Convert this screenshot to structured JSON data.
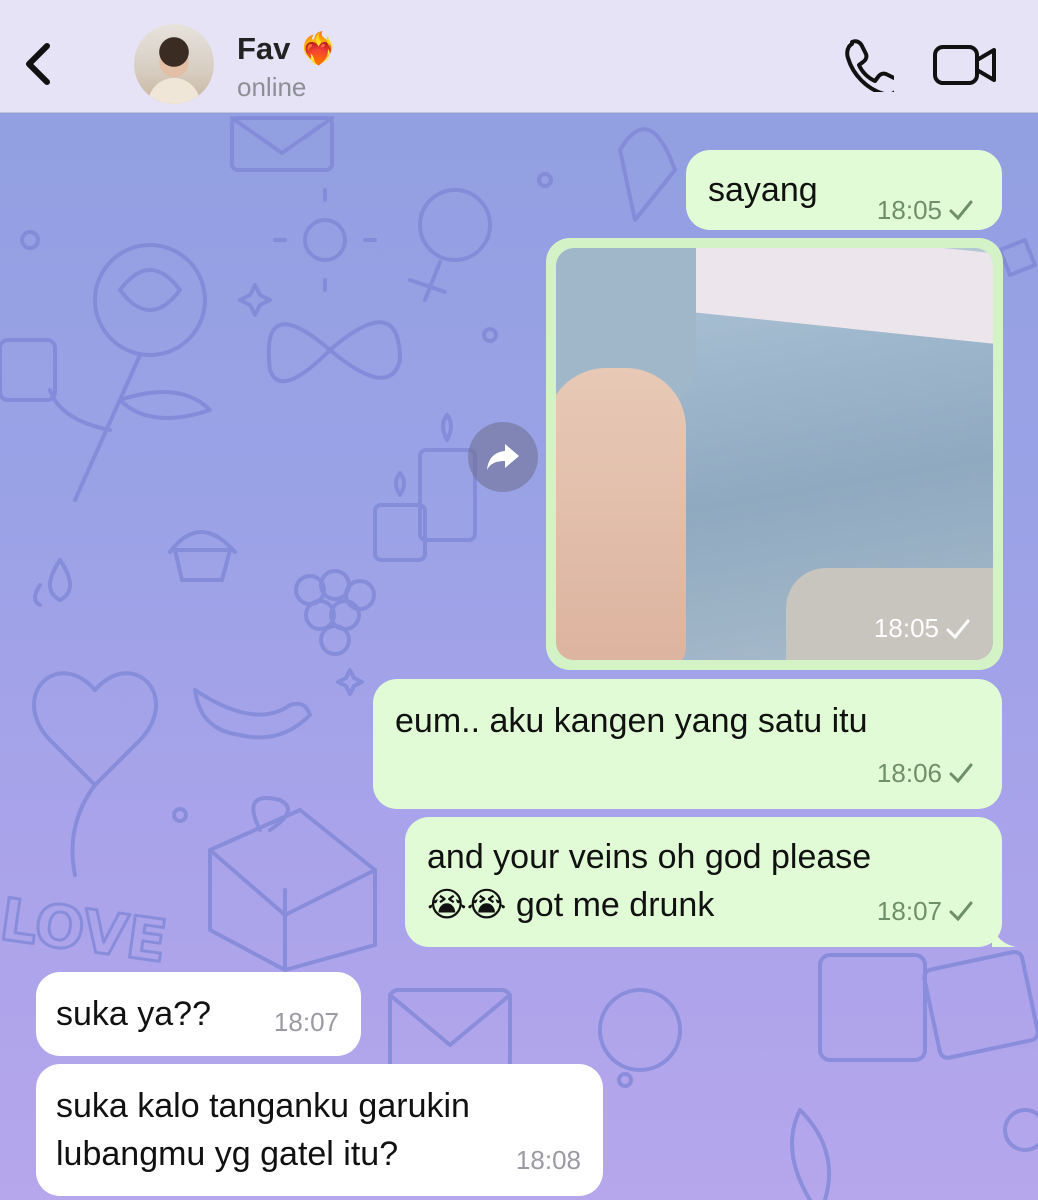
{
  "header": {
    "contact_name": "Fav ❤️‍🔥",
    "status": "online"
  },
  "icons": {
    "back": "chevron-left-icon",
    "call": "phone-icon",
    "video": "video-camera-icon",
    "share": "share-arrow-icon",
    "read": "checkmark-icon"
  },
  "colors": {
    "outgoing_bubble": "#e1fbd6",
    "incoming_bubble": "#ffffff",
    "header_bg": "#e8e6f6"
  },
  "messages": [
    {
      "direction": "out",
      "text": "sayang",
      "time": "18:05",
      "read": true
    },
    {
      "direction": "out",
      "type": "photo",
      "time": "18:05",
      "read": true
    },
    {
      "direction": "out",
      "text": "eum.. aku kangen yang satu itu",
      "time": "18:06",
      "read": true
    },
    {
      "direction": "out",
      "text": "and your veins oh god please\n😭😭 got me drunk",
      "time": "18:07",
      "read": true
    },
    {
      "direction": "in",
      "text": "suka ya??",
      "time": "18:07"
    },
    {
      "direction": "in",
      "text": "suka kalo tanganku garukin\nlubangmu yg gatel itu?",
      "time": "18:08"
    }
  ]
}
